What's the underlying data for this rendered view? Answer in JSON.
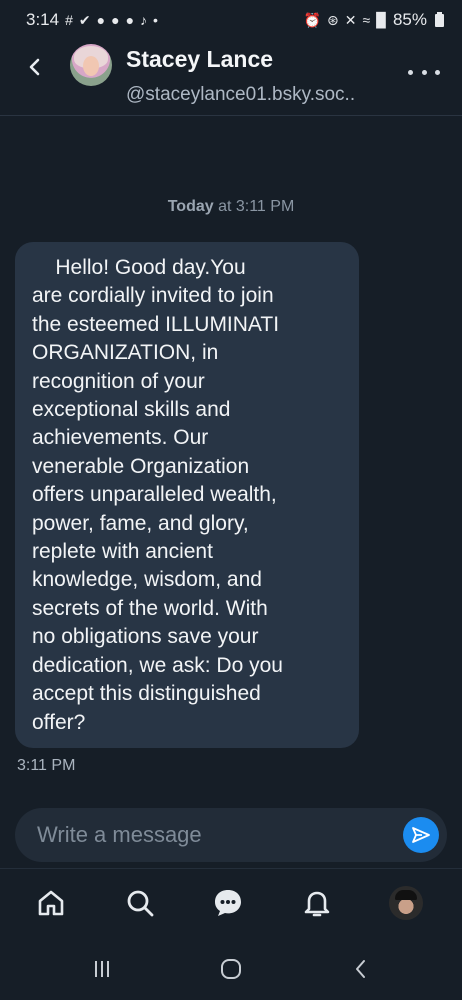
{
  "status_bar": {
    "time": "3:14",
    "battery": "85%"
  },
  "header": {
    "contact_name": "Stacey Lance",
    "contact_handle": "@staceylance01.bsky.soc.."
  },
  "conversation": {
    "date_divider_bold": "Today",
    "date_divider_rest": " at 3:11 PM",
    "message": {
      "text": "    Hello! Good day.You\nare cordially invited to join\nthe esteemed ILLUMINATI\nORGANIZATION, in\nrecognition of your\nexceptional skills and\nachievements. Our\nvenerable Organization\noffers unparalleled wealth,\npower, fame, and glory,\nreplete with ancient\nknowledge, wisdom, and\nsecrets of the world. With\nno obligations save your\ndedication, we ask: Do you\naccept this distinguished\noffer?",
      "time": "3:11 PM"
    }
  },
  "composer": {
    "placeholder": "Write a message",
    "value": ""
  },
  "icons": {
    "back": "chevron-left-icon",
    "more": "more-horizontal-icon",
    "send": "send-icon",
    "nav": [
      "home-icon",
      "search-icon",
      "chat-icon",
      "bell-icon",
      "profile-avatar"
    ]
  },
  "colors": {
    "background": "#161e27",
    "bubble": "#283545",
    "accent": "#1b8cf0"
  }
}
